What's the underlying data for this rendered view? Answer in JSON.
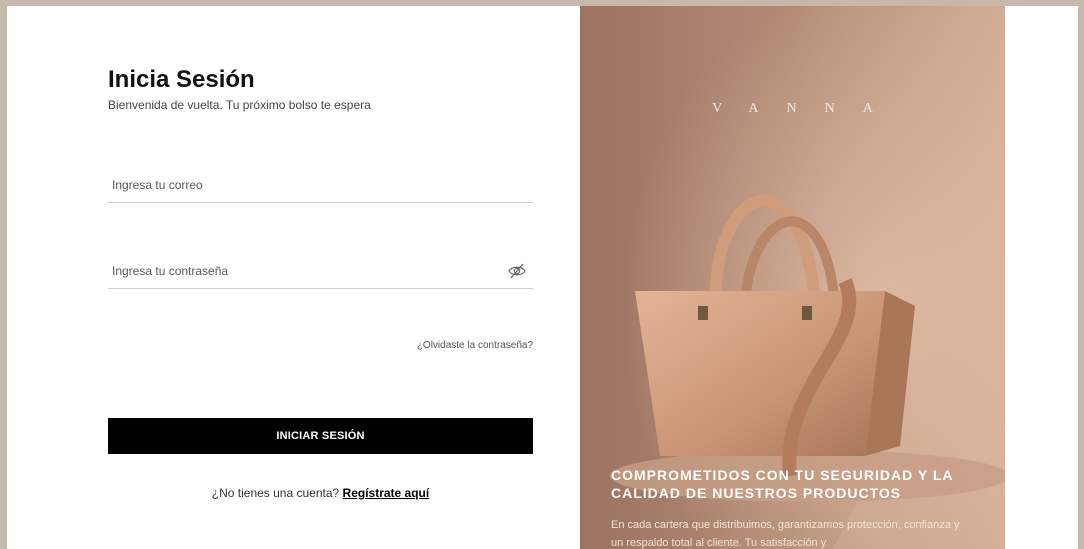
{
  "login": {
    "title": "Inicia Sesión",
    "subtitle": "Bienvenida de vuelta. Tu próximo bolso te espera",
    "email_placeholder": "Ingresa tu correo",
    "password_placeholder": "Ingresa tu contraseña",
    "toggle_icon": "eye-slash-icon",
    "forgot_label": "¿Olvidaste la contraseña?",
    "submit_label": "INICIAR SESIÓN",
    "register_prompt": "¿No tienes una cuenta?",
    "register_link": "Regístrate aquí"
  },
  "hero": {
    "brand": "VANNA",
    "heading": "COMPROMETIDOS CON TU SEGURIDAD Y LA CALIDAD DE NUESTROS PRODUCTOS",
    "text": "En cada cartera que distribuimos, garantizamos protección, confianza y un respaldo total al cliente. Tu satisfacción y"
  },
  "colors": {
    "frame": "#c6b9ab",
    "button": "#000000",
    "hero_tone": "#b38a73"
  }
}
